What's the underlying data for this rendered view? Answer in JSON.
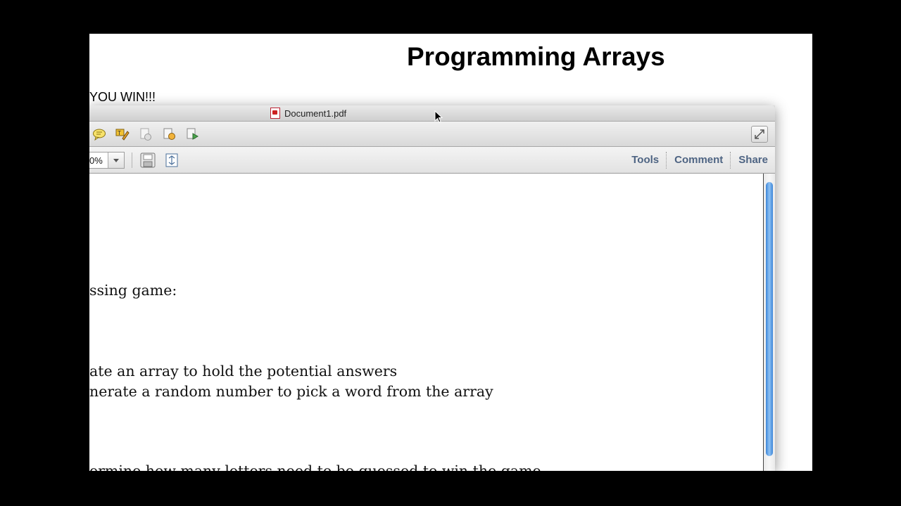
{
  "slide": {
    "title": "Programming Arrays",
    "line1": "YOU WIN!!!"
  },
  "window": {
    "title": "Document1.pdf",
    "zoom": "0%",
    "links": {
      "tools": "Tools",
      "comment": "Comment",
      "share": "Share"
    }
  },
  "document": {
    "lines": [
      "ssing game:",
      "ate an array to hold the potential answers",
      "nerate a random number to pick a word from the array",
      "ermine how many letters need to be guessed to win the game"
    ]
  },
  "colors": {
    "background": "#000000",
    "link": "#4e6483",
    "scroll_thumb": "#3b85d8"
  }
}
